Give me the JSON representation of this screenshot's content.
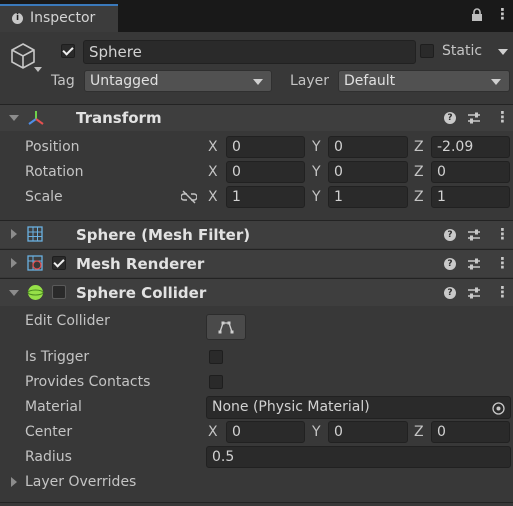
{
  "tab": {
    "title": "Inspector"
  },
  "object": {
    "name": "Sphere",
    "active": true,
    "static_label": "Static",
    "tag_label": "Tag",
    "tag_value": "Untagged",
    "layer_label": "Layer",
    "layer_value": "Default"
  },
  "transform": {
    "title": "Transform",
    "axes": {
      "x": "X",
      "y": "Y",
      "z": "Z"
    },
    "position": {
      "label": "Position",
      "x": "0",
      "y": "0",
      "z": "-2.09"
    },
    "rotation": {
      "label": "Rotation",
      "x": "0",
      "y": "0",
      "z": "0"
    },
    "scale": {
      "label": "Scale",
      "x": "1",
      "y": "1",
      "z": "1"
    }
  },
  "mesh_filter": {
    "title": "Sphere (Mesh Filter)"
  },
  "mesh_renderer": {
    "title": "Mesh Renderer",
    "enabled": true
  },
  "sphere_collider": {
    "title": "Sphere Collider",
    "enabled": false,
    "edit_collider_label": "Edit Collider",
    "is_trigger_label": "Is Trigger",
    "provides_contacts_label": "Provides Contacts",
    "material_label": "Material",
    "material_value": "None (Physic Material)",
    "center_label": "Center",
    "center": {
      "x": "0",
      "y": "0",
      "z": "0"
    },
    "radius_label": "Radius",
    "radius_value": "0.5",
    "layer_overrides_label": "Layer Overrides"
  },
  "colors": {
    "accent": "#3a79bb",
    "background": "#383838",
    "header": "#3e3e3e",
    "field": "#2a2a2a"
  }
}
